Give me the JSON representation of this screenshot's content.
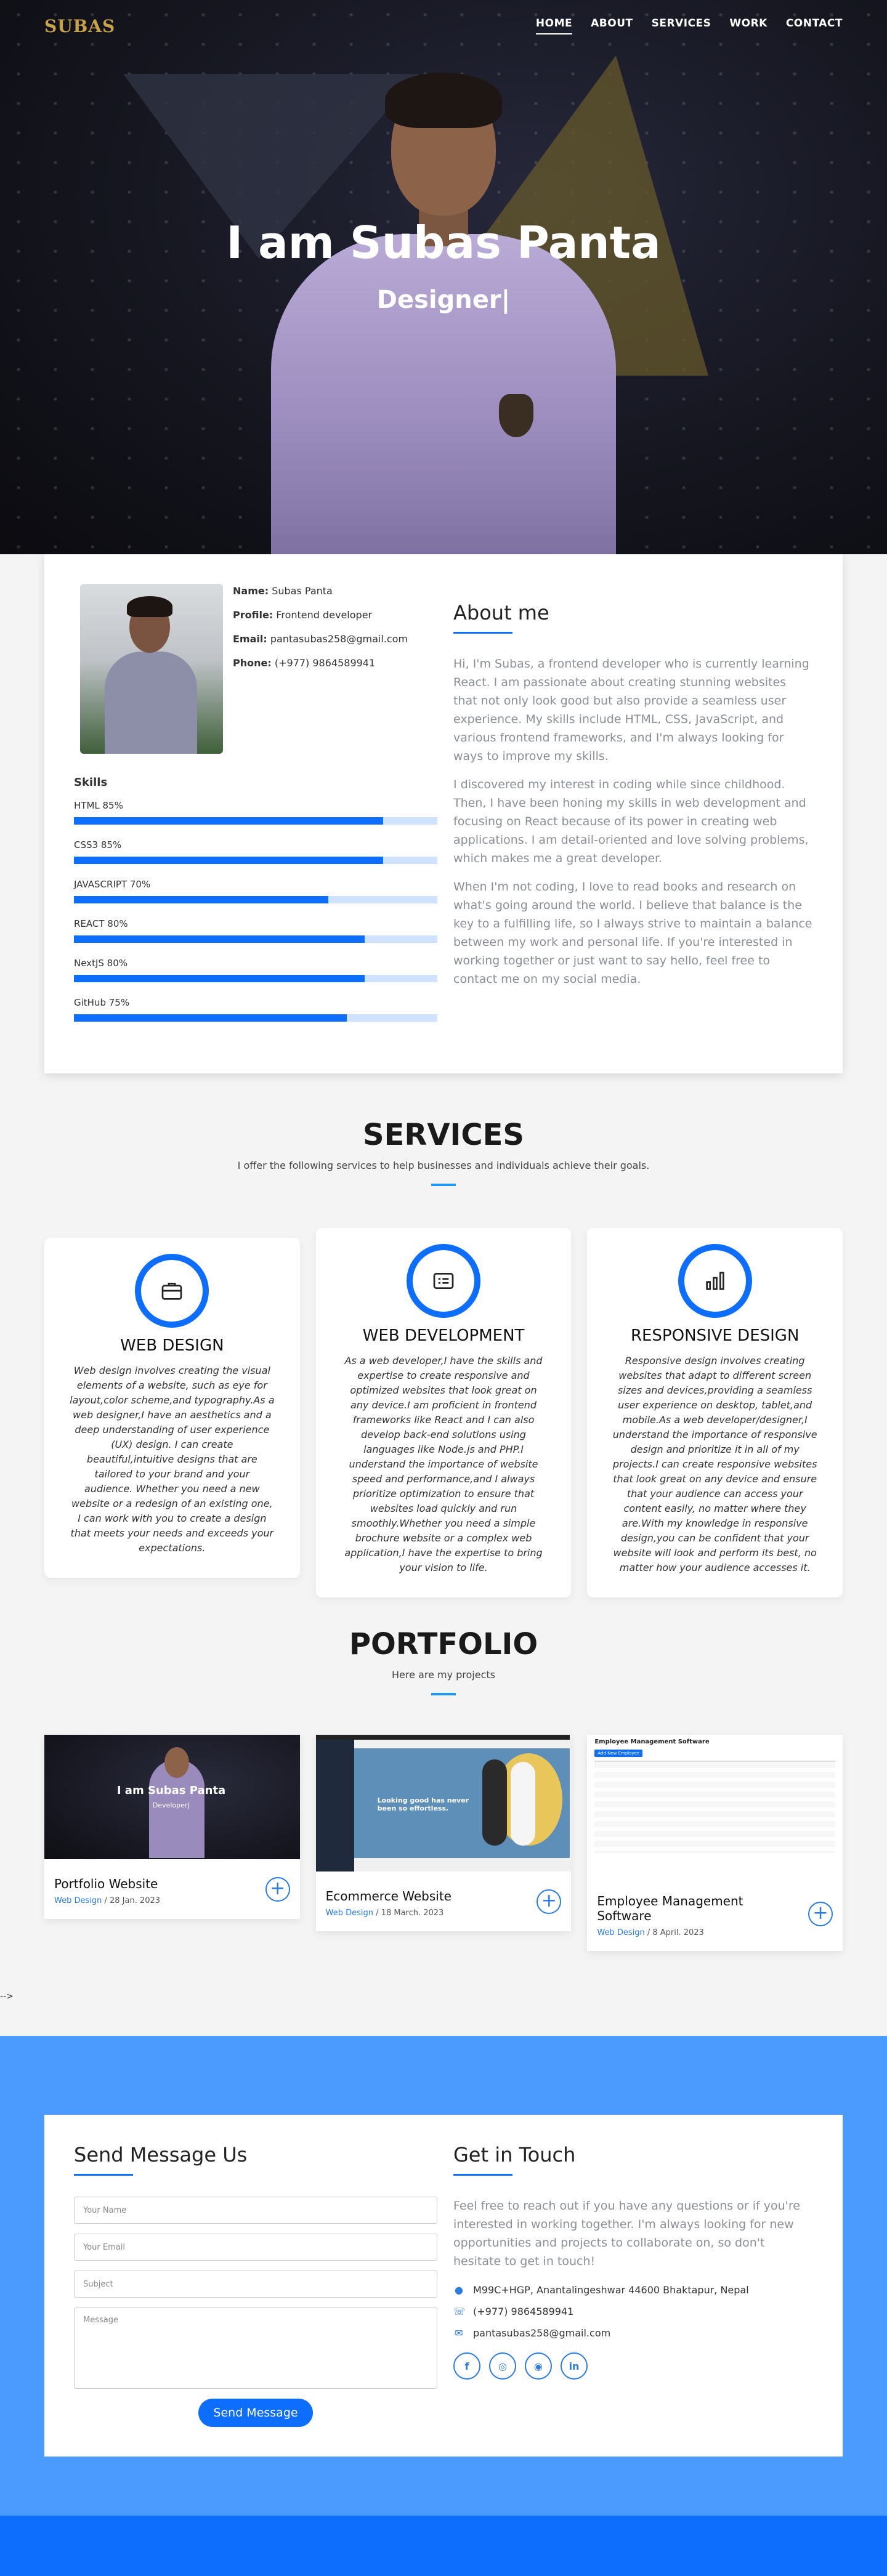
{
  "nav": {
    "logo": "SUBAS",
    "links": [
      "HOME",
      "ABOUT",
      "SERVICES",
      "WORK",
      "CONTACT"
    ]
  },
  "hero": {
    "title": "I am Subas Panta",
    "subtitle": "Designer|"
  },
  "about": {
    "name_label": "Name:",
    "name": "Subas Panta",
    "profile_label": "Profile:",
    "profile": "Frontend developer",
    "email_label": "Email:",
    "email": "pantasubas258@gmail.com",
    "phone_label": "Phone:",
    "phone": "(+977) 9864589941",
    "skills_title": "Skills",
    "skills": [
      {
        "label": "HTML 85%",
        "value": 0.85
      },
      {
        "label": "CSS3 85%",
        "value": 0.85
      },
      {
        "label": "JAVASCRIPT 70%",
        "value": 0.7
      },
      {
        "label": "REACT 80%",
        "value": 0.8
      },
      {
        "label": "NextJS 80%",
        "value": 0.8
      },
      {
        "label": "GitHub 75%",
        "value": 0.75
      }
    ],
    "heading": "About me",
    "paragraphs": [
      "Hi, I'm Subas, a frontend developer who is currently learning React. I am passionate about creating stunning websites that not only look good but also provide a seamless user experience. My skills include HTML, CSS, JavaScript, and various frontend frameworks, and I'm always looking for ways to improve my skills.",
      "I discovered my interest in coding while since childhood. Then, I have been honing my skills in web development and focusing on React because of its power in creating web applications. I am detail-oriented and love solving problems, which makes me a great developer.",
      "When I'm not coding, I love to read books and research on what's going around the world. I believe that balance is the key to a fulfilling life, so I always strive to maintain a balance between my work and personal life. If you're interested in working together or just want to say hello, feel free to contact me on my social media."
    ]
  },
  "services": {
    "title": "SERVICES",
    "subtitle": "I offer the following services to help businesses and individuals achieve their goals.",
    "items": [
      {
        "name": "WEB DESIGN",
        "icon": "briefcase-icon",
        "desc": "Web design involves creating the visual elements of a website, such as eye for layout,color scheme,and typography.As a web designer,I have an aesthetics and a deep understanding of user experience (UX) design. I can create beautiful,intuitive designs that are tailored to your brand and your audience. Whether you need a new website or a redesign of an existing one, I can work with you to create a design that meets your needs and exceeds your expectations."
      },
      {
        "name": "WEB DEVELOPMENT",
        "icon": "card-list-icon",
        "desc": "As a web developer,I have the skills and expertise to create responsive and optimized websites that look great on any device.I am proficient in frontend frameworks like React and I can also develop back-end solutions using languages like Node.js and PHP.I understand the importance of website speed and performance,and I always prioritize optimization to ensure that websites load quickly and run smoothly.Whether you need a simple brochure website or a complex web application,I have the expertise to bring your vision to life."
      },
      {
        "name": "RESPONSIVE DESIGN",
        "icon": "bar-chart-icon",
        "desc": "Responsive design involves creating websites that adapt to different screen sizes and devices,providing a seamless user experience on desktop, tablet,and mobile.As a web developer/designer,I understand the importance of responsive design and prioritize it in all of my projects.I can create responsive websites that look great on any device and ensure that your audience can access your content easily, no matter where they are.With my knowledge in responsive design,you can be confident that your website will look and perform its best, no matter how your audience accesses it."
      }
    ]
  },
  "portfolio": {
    "title": "PORTFOLIO",
    "subtitle": "Here are my projects",
    "items": [
      {
        "title": "Portfolio Website",
        "category": "Web Design",
        "date": " / 28 Jan. 2023",
        "thumb_title": "I am Subas Panta",
        "thumb_sub": "Developer|"
      },
      {
        "title": "Ecommerce Website",
        "category": "Web Design",
        "date": " / 18 March. 2023",
        "thumb_title": "Looking good has never been so effortless."
      },
      {
        "title": "Employee Management Software",
        "category": "Web Design",
        "date": " / 8 April. 2023",
        "thumb_title": "Employee Management Software",
        "thumb_button": "Add New Employee"
      }
    ]
  },
  "stray": "-->",
  "contact": {
    "send_heading": "Send Message Us",
    "placeholders": [
      "Your Name",
      "Your Email",
      "Subject",
      "Message"
    ],
    "send_button": "Send Message",
    "touch_heading": "Get in Touch",
    "touch_text": "Feel free to reach out if you have any questions or if you're interested in working together. I'm always looking for new opportunities and projects to collaborate on, so don't hesitate to get in touch!",
    "address": "M99C+HGP, Anantalingeshwar 44600 Bhaktapur, Nepal",
    "phone": "(+977) 9864589941",
    "email": "pantasubas258@gmail.com",
    "socials": [
      "facebook-icon",
      "instagram-icon",
      "github-icon",
      "linkedin-icon"
    ]
  },
  "colors": {
    "accent": "#0d6efd",
    "contact_bg": "#4b9bff",
    "logo": "#c8a24a"
  }
}
